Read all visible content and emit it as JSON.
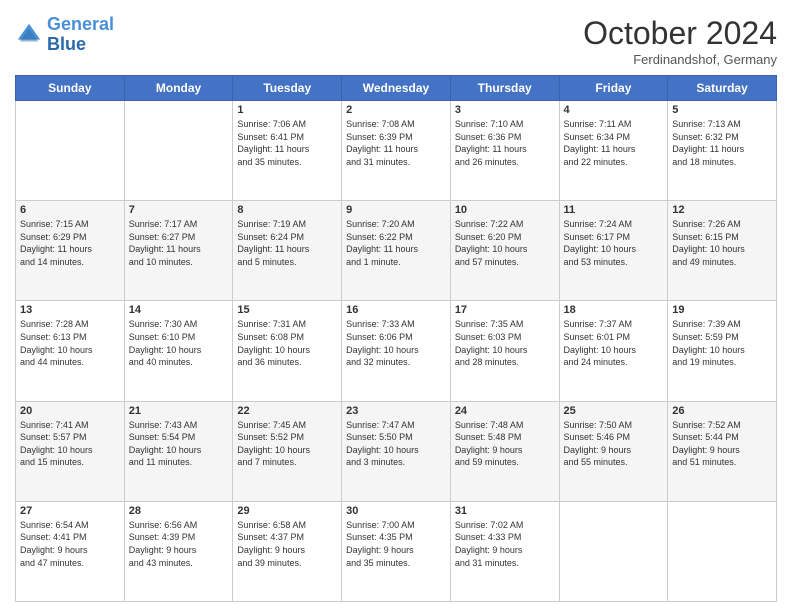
{
  "header": {
    "logo_line1": "General",
    "logo_line2": "Blue",
    "month": "October 2024",
    "location": "Ferdinandshof, Germany"
  },
  "days_of_week": [
    "Sunday",
    "Monday",
    "Tuesday",
    "Wednesday",
    "Thursday",
    "Friday",
    "Saturday"
  ],
  "weeks": [
    [
      {
        "day": "",
        "info": ""
      },
      {
        "day": "",
        "info": ""
      },
      {
        "day": "1",
        "info": "Sunrise: 7:06 AM\nSunset: 6:41 PM\nDaylight: 11 hours\nand 35 minutes."
      },
      {
        "day": "2",
        "info": "Sunrise: 7:08 AM\nSunset: 6:39 PM\nDaylight: 11 hours\nand 31 minutes."
      },
      {
        "day": "3",
        "info": "Sunrise: 7:10 AM\nSunset: 6:36 PM\nDaylight: 11 hours\nand 26 minutes."
      },
      {
        "day": "4",
        "info": "Sunrise: 7:11 AM\nSunset: 6:34 PM\nDaylight: 11 hours\nand 22 minutes."
      },
      {
        "day": "5",
        "info": "Sunrise: 7:13 AM\nSunset: 6:32 PM\nDaylight: 11 hours\nand 18 minutes."
      }
    ],
    [
      {
        "day": "6",
        "info": "Sunrise: 7:15 AM\nSunset: 6:29 PM\nDaylight: 11 hours\nand 14 minutes."
      },
      {
        "day": "7",
        "info": "Sunrise: 7:17 AM\nSunset: 6:27 PM\nDaylight: 11 hours\nand 10 minutes."
      },
      {
        "day": "8",
        "info": "Sunrise: 7:19 AM\nSunset: 6:24 PM\nDaylight: 11 hours\nand 5 minutes."
      },
      {
        "day": "9",
        "info": "Sunrise: 7:20 AM\nSunset: 6:22 PM\nDaylight: 11 hours\nand 1 minute."
      },
      {
        "day": "10",
        "info": "Sunrise: 7:22 AM\nSunset: 6:20 PM\nDaylight: 10 hours\nand 57 minutes."
      },
      {
        "day": "11",
        "info": "Sunrise: 7:24 AM\nSunset: 6:17 PM\nDaylight: 10 hours\nand 53 minutes."
      },
      {
        "day": "12",
        "info": "Sunrise: 7:26 AM\nSunset: 6:15 PM\nDaylight: 10 hours\nand 49 minutes."
      }
    ],
    [
      {
        "day": "13",
        "info": "Sunrise: 7:28 AM\nSunset: 6:13 PM\nDaylight: 10 hours\nand 44 minutes."
      },
      {
        "day": "14",
        "info": "Sunrise: 7:30 AM\nSunset: 6:10 PM\nDaylight: 10 hours\nand 40 minutes."
      },
      {
        "day": "15",
        "info": "Sunrise: 7:31 AM\nSunset: 6:08 PM\nDaylight: 10 hours\nand 36 minutes."
      },
      {
        "day": "16",
        "info": "Sunrise: 7:33 AM\nSunset: 6:06 PM\nDaylight: 10 hours\nand 32 minutes."
      },
      {
        "day": "17",
        "info": "Sunrise: 7:35 AM\nSunset: 6:03 PM\nDaylight: 10 hours\nand 28 minutes."
      },
      {
        "day": "18",
        "info": "Sunrise: 7:37 AM\nSunset: 6:01 PM\nDaylight: 10 hours\nand 24 minutes."
      },
      {
        "day": "19",
        "info": "Sunrise: 7:39 AM\nSunset: 5:59 PM\nDaylight: 10 hours\nand 19 minutes."
      }
    ],
    [
      {
        "day": "20",
        "info": "Sunrise: 7:41 AM\nSunset: 5:57 PM\nDaylight: 10 hours\nand 15 minutes."
      },
      {
        "day": "21",
        "info": "Sunrise: 7:43 AM\nSunset: 5:54 PM\nDaylight: 10 hours\nand 11 minutes."
      },
      {
        "day": "22",
        "info": "Sunrise: 7:45 AM\nSunset: 5:52 PM\nDaylight: 10 hours\nand 7 minutes."
      },
      {
        "day": "23",
        "info": "Sunrise: 7:47 AM\nSunset: 5:50 PM\nDaylight: 10 hours\nand 3 minutes."
      },
      {
        "day": "24",
        "info": "Sunrise: 7:48 AM\nSunset: 5:48 PM\nDaylight: 9 hours\nand 59 minutes."
      },
      {
        "day": "25",
        "info": "Sunrise: 7:50 AM\nSunset: 5:46 PM\nDaylight: 9 hours\nand 55 minutes."
      },
      {
        "day": "26",
        "info": "Sunrise: 7:52 AM\nSunset: 5:44 PM\nDaylight: 9 hours\nand 51 minutes."
      }
    ],
    [
      {
        "day": "27",
        "info": "Sunrise: 6:54 AM\nSunset: 4:41 PM\nDaylight: 9 hours\nand 47 minutes."
      },
      {
        "day": "28",
        "info": "Sunrise: 6:56 AM\nSunset: 4:39 PM\nDaylight: 9 hours\nand 43 minutes."
      },
      {
        "day": "29",
        "info": "Sunrise: 6:58 AM\nSunset: 4:37 PM\nDaylight: 9 hours\nand 39 minutes."
      },
      {
        "day": "30",
        "info": "Sunrise: 7:00 AM\nSunset: 4:35 PM\nDaylight: 9 hours\nand 35 minutes."
      },
      {
        "day": "31",
        "info": "Sunrise: 7:02 AM\nSunset: 4:33 PM\nDaylight: 9 hours\nand 31 minutes."
      },
      {
        "day": "",
        "info": ""
      },
      {
        "day": "",
        "info": ""
      }
    ]
  ]
}
